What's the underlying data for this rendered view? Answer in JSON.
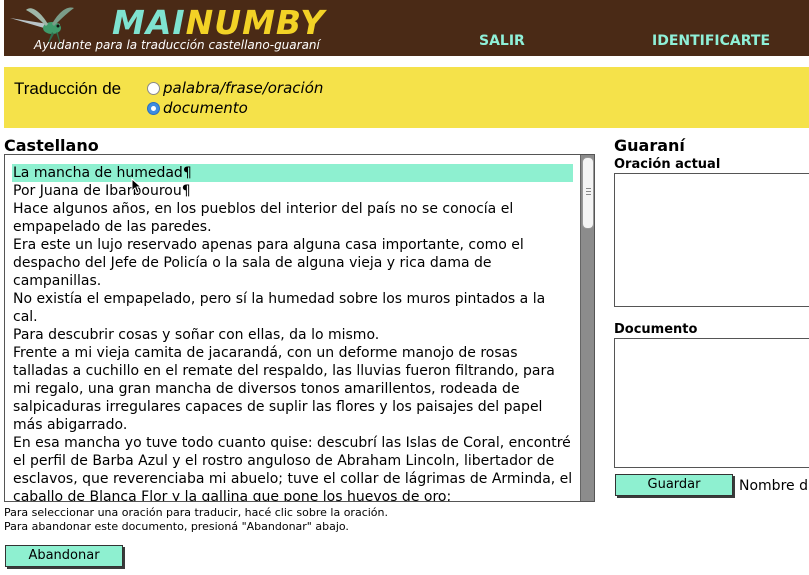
{
  "header": {
    "brand_part1": "MAI",
    "brand_part2": "NUMBY",
    "tagline": "Ayudante para la traducción castellano-guaraní",
    "nav": {
      "salir": "SALIR",
      "identificarte": "IDENTIFICARTE"
    },
    "logo_icon": "hummingbird-logo"
  },
  "mode": {
    "label": "Traducción de",
    "options": [
      {
        "label": "palabra/frase/oración",
        "checked": false
      },
      {
        "label": "documento",
        "checked": true
      }
    ]
  },
  "castellano": {
    "title": "Castellano",
    "sentences": [
      "La mancha de humedad¶",
      "Por Juana de Ibarbourou¶",
      "Hace algunos años, en los pueblos del interior del país no se conocía el empapelado de las paredes.",
      "Era este un lujo reservado apenas para alguna casa importante, como el despacho del Jefe de Policía o la sala de alguna vieja y rica dama de campanillas.",
      "No existía el empapelado, pero sí la humedad sobre los muros pintados a la cal.",
      "Para descubrir cosas y soñar con ellas, da lo mismo.",
      "Frente a mi vieja camita de jacarandá, con un deforme manojo de rosas talladas a cuchillo en el remate del respaldo, las lluvias fueron filtrando, para mi regalo, una gran mancha de diversos tonos amarillentos, rodeada de salpicaduras irregulares capaces de suplir las flores y los paisajes del papel más abigarrado.",
      "En esa mancha yo tuve todo cuanto quise: descubrí las Islas de Coral, encontré el perfil de Barba Azul y el rostro anguloso de Abraham Lincoln, libertador de esclavos, que reverenciaba mi abuelo; tuve el collar de lágrimas de Arminda, el caballo de Blanca Flor y la gallina que pone los huevos de oro;"
    ],
    "highlighted_index": 0,
    "hint1": "Para seleccionar una oración para traducir, hacé clic sobre la oración.",
    "hint2": "Para abandonar este documento, presioná \"Abandonar\" abajo.",
    "abandonar_label": "Abandonar"
  },
  "guarani": {
    "title": "Guaraní",
    "oracion_actual_label": "Oración actual",
    "oracion_actual_value": "",
    "documento_label": "Documento",
    "documento_value": "",
    "guardar_label": "Guardar",
    "nombre_label": "Nombre d"
  },
  "colors": {
    "header_bg": "#4a2a16",
    "brand_teal": "#7fe3d0",
    "brand_yellow": "#f2d226",
    "mode_bar_bg": "#f5e24a",
    "button_bg": "#8ef0d0",
    "highlight": "#8ef0d0"
  }
}
